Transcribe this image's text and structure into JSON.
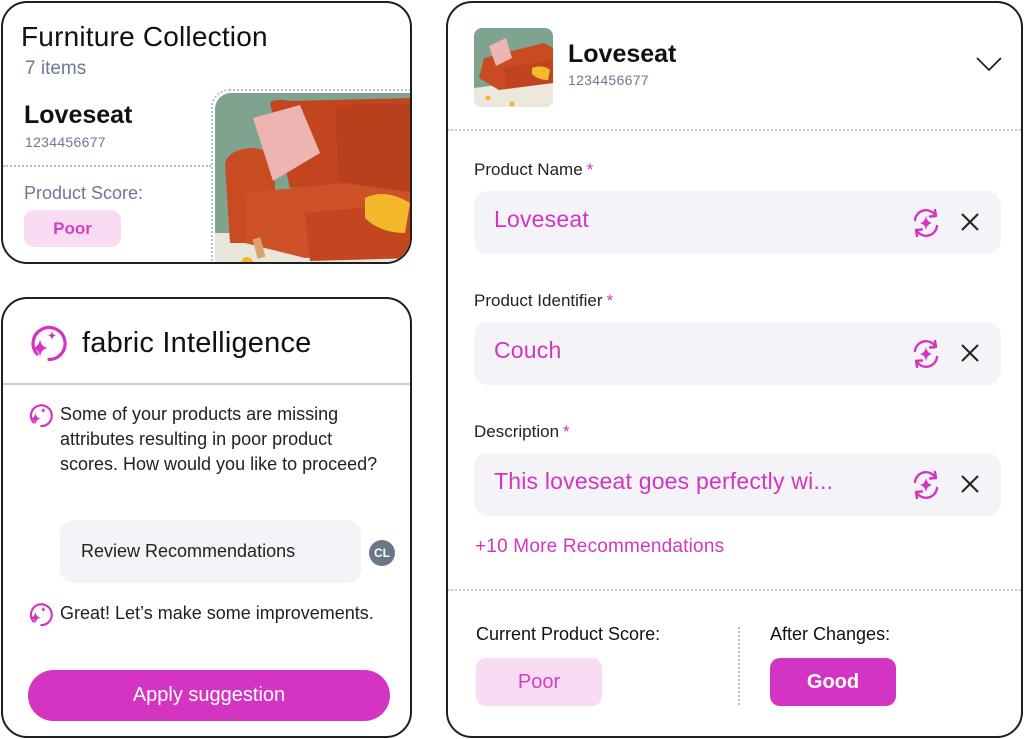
{
  "collection": {
    "title": "Furniture Collection",
    "item_count": "7 items",
    "product_name": "Loveseat",
    "product_id": "1234456677",
    "score_label": "Product Score:",
    "score_value": "Poor",
    "image_alt": "orange loveseat with pink pillow"
  },
  "chat": {
    "title": "fabric Intelligence",
    "messages": [
      {
        "role": "assistant",
        "text": "Some of your products are missing attributes resulting in poor product scores. How would you like to proceed?"
      },
      {
        "role": "user",
        "text": "Review Recommendations",
        "avatar_initials": "CL"
      },
      {
        "role": "assistant",
        "text": "Great! Let’s make some improvements."
      }
    ],
    "action_button": "Apply suggestion"
  },
  "detail": {
    "product_name": "Loveseat",
    "product_id": "1234456677",
    "fields": [
      {
        "label": "Product Name",
        "required_mark": "*",
        "value": "Loveseat"
      },
      {
        "label": "Product Identifier",
        "required_mark": "*",
        "value": "Couch"
      },
      {
        "label": "Description",
        "required_mark": "*",
        "value": "This loveseat goes perfectly wi..."
      }
    ],
    "more_link": "+10 More Recommendations",
    "current_score_label": "Current Product Score:",
    "current_score": "Poor",
    "after_label": "After Changes:",
    "after_score": "Good"
  },
  "colors": {
    "accent": "#d335c2",
    "accent_light": "#f8dcf4",
    "field_bg": "#f3f3f8",
    "muted_text": "#6b7a92"
  }
}
